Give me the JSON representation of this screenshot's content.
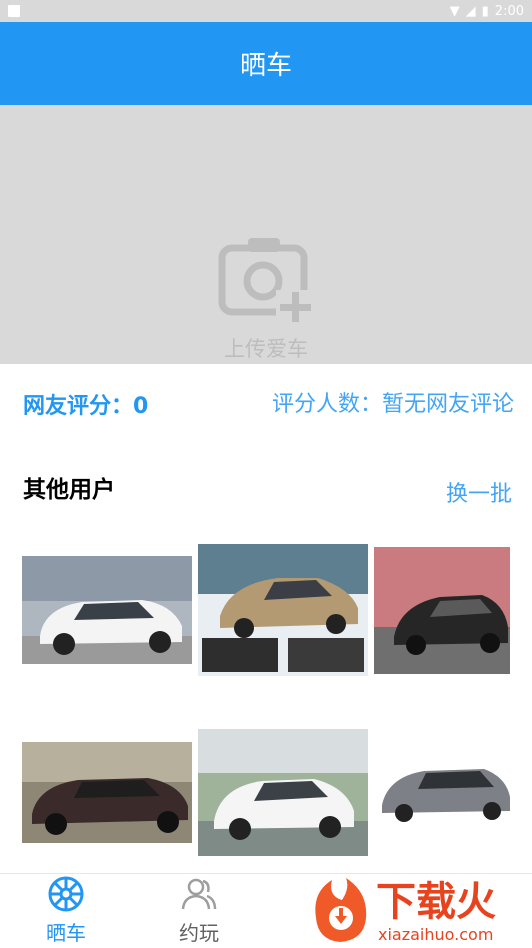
{
  "status_bar": {
    "time": "2:00"
  },
  "header": {
    "title": "晒车"
  },
  "upload": {
    "label": "上传爱车"
  },
  "stats": {
    "rating": "网友评分：0",
    "raters": "评分人数：暂无网友评论"
  },
  "section": {
    "title": "其他用户",
    "refresh_label": "换一批"
  },
  "bottom_nav": {
    "items": [
      {
        "label": "晒车",
        "icon": "steering-wheel-icon",
        "active": true
      },
      {
        "label": "约玩",
        "icon": "users-icon",
        "active": false
      }
    ]
  },
  "watermark": {
    "brand": "下载火",
    "url": "xiazaihuo.com"
  },
  "colors": {
    "primary": "#2196f3",
    "accent": "#42a5f5",
    "inactive": "#9e9e9e"
  }
}
